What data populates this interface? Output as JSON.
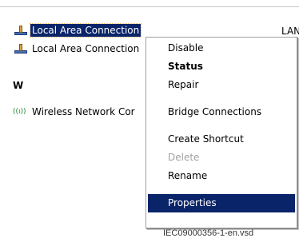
{
  "list": {
    "items": [
      {
        "label": "Local Area Connection",
        "selected": true,
        "icon": "lan-connection-icon"
      },
      {
        "label": "Local Area Connection",
        "selected": false,
        "icon": "lan-connection-icon"
      }
    ],
    "right_col_text": "LAN",
    "section_letter": "W",
    "wireless": {
      "label": "Wireless Network Cor",
      "icon": "wireless-connection-icon",
      "icon_glyph": "((ı))"
    }
  },
  "context_menu": {
    "items": [
      {
        "label": "Disable",
        "style": "normal"
      },
      {
        "label": "Status",
        "style": "bold"
      },
      {
        "label": "Repair",
        "style": "normal"
      },
      {
        "label": "Bridge Connections",
        "style": "normal"
      },
      {
        "label": "Create Shortcut",
        "style": "normal"
      },
      {
        "label": "Delete",
        "style": "disabled"
      },
      {
        "label": "Rename",
        "style": "normal"
      },
      {
        "label": "Properties",
        "style": "highlight"
      }
    ]
  },
  "caption": "IEC09000356-1-en.vsd",
  "colors": {
    "selection": "#0a246a",
    "disabled_text": "#a0a0a0"
  }
}
